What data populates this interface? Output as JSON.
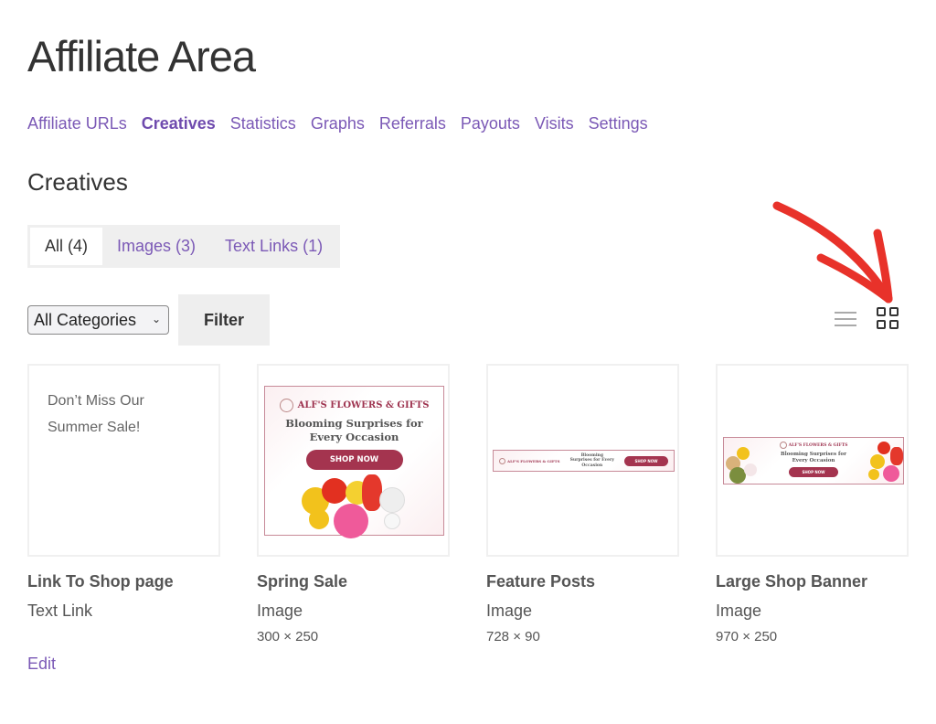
{
  "page": {
    "title": "Affiliate Area",
    "section_title": "Creatives"
  },
  "nav": {
    "items": [
      {
        "label": "Affiliate URLs",
        "active": false
      },
      {
        "label": "Creatives",
        "active": true
      },
      {
        "label": "Statistics",
        "active": false
      },
      {
        "label": "Graphs",
        "active": false
      },
      {
        "label": "Referrals",
        "active": false
      },
      {
        "label": "Payouts",
        "active": false
      },
      {
        "label": "Visits",
        "active": false
      },
      {
        "label": "Settings",
        "active": false
      }
    ]
  },
  "tabs": [
    {
      "label": "All (4)",
      "active": true
    },
    {
      "label": "Images (3)",
      "active": false
    },
    {
      "label": "Text Links (1)",
      "active": false
    }
  ],
  "filters": {
    "category_selected": "All Categories",
    "filter_label": "Filter"
  },
  "view": {
    "list_icon": "list-view-icon",
    "grid_icon": "grid-view-icon",
    "selected": "grid",
    "annotation_color": "#e8322a"
  },
  "creatives": [
    {
      "name": "Link To Shop page",
      "type": "Text Link",
      "dimensions": "",
      "preview_text": [
        "Don’t Miss Our",
        "Summer Sale!"
      ],
      "edit_label": "Edit"
    },
    {
      "name": "Spring Sale",
      "type": "Image",
      "dimensions": "300 × 250",
      "banner": {
        "brand": "ALF'S FLOWERS & GIFTS",
        "headline_1": "Blooming Surprises for",
        "headline_2": "Every Occasion",
        "cta": "SHOP NOW"
      }
    },
    {
      "name": "Feature Posts",
      "type": "Image",
      "dimensions": "728 × 90",
      "banner": {
        "brand": "ALF'S FLOWERS & GIFTS",
        "headline_1": "Blooming",
        "headline_2": "Surprises for Every",
        "headline_3": "Occasion",
        "cta": "SHOP NOW"
      }
    },
    {
      "name": "Large Shop Banner",
      "type": "Image",
      "dimensions": "970 × 250",
      "banner": {
        "brand": "ALF'S FLOWERS & GIFTS",
        "headline_1": "Blooming Surprises for",
        "headline_2": "Every Occasion",
        "cta": "SHOP NOW"
      }
    }
  ],
  "colors": {
    "link": "#7b59b6",
    "banner_accent": "#a4344f"
  }
}
